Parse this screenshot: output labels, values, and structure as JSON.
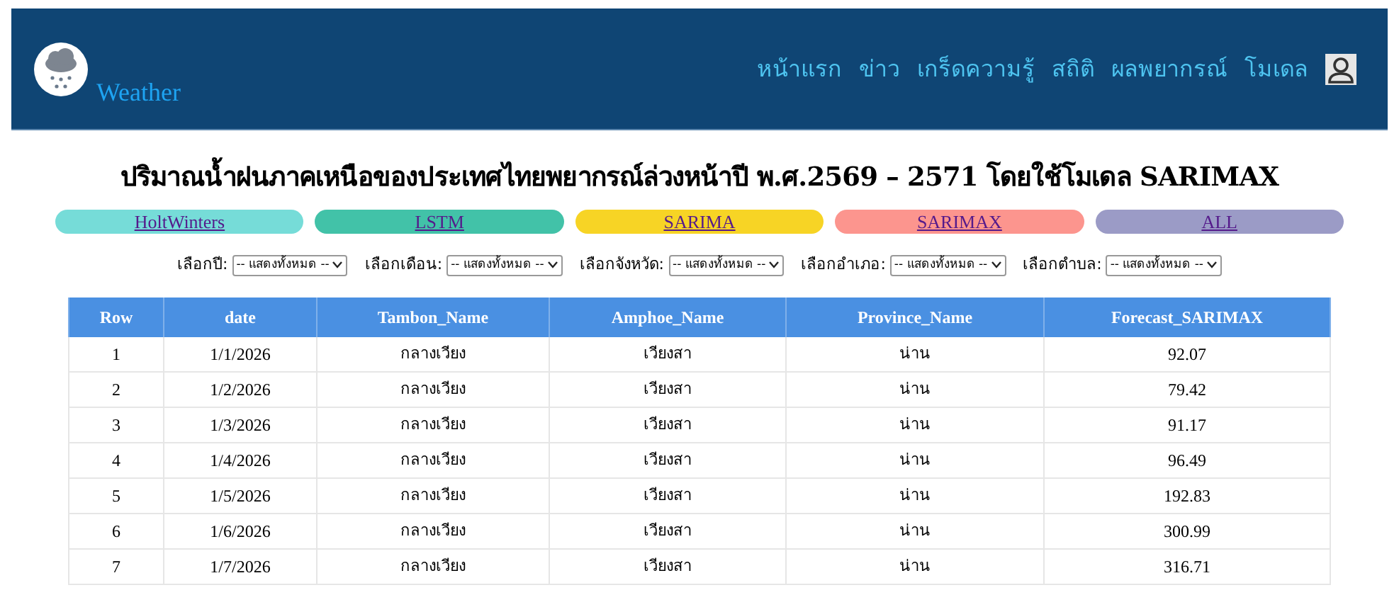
{
  "header": {
    "brand": "Weather",
    "nav": [
      "หน้าแรก",
      "ข่าว",
      "เกร็ดความรู้",
      "สถิติ",
      "ผลพยากรณ์",
      "โมเดล"
    ]
  },
  "title": "ปริมาณน้ำฝนภาคเหนือของประเทศไทยพยากรณ์ล่วงหน้าปี พ.ศ.2569 – 2571 โดยใช้โมเดล SARIMAX",
  "model_tabs": [
    {
      "label": "HoltWinters",
      "color": "#76dcd8"
    },
    {
      "label": "LSTM",
      "color": "#42c2a8"
    },
    {
      "label": "SARIMA",
      "color": "#f7d425"
    },
    {
      "label": "SARIMAX",
      "color": "#fc958e"
    },
    {
      "label": "ALL",
      "color": "#9b9bc6"
    }
  ],
  "filters": [
    {
      "label": "เลือกปี:",
      "value": "-- แสดงทั้งหมด --"
    },
    {
      "label": "เลือกเดือน:",
      "value": "-- แสดงทั้งหมด --"
    },
    {
      "label": "เลือกจังหวัด:",
      "value": "-- แสดงทั้งหมด --"
    },
    {
      "label": "เลือกอำเภอ:",
      "value": "-- แสดงทั้งหมด --"
    },
    {
      "label": "เลือกตำบล:",
      "value": "-- แสดงทั้งหมด --"
    }
  ],
  "table": {
    "columns": [
      "Row",
      "date",
      "Tambon_Name",
      "Amphoe_Name",
      "Province_Name",
      "Forecast_SARIMAX"
    ],
    "rows": [
      [
        "1",
        "1/1/2026",
        "กลางเวียง",
        "เวียงสา",
        "น่าน",
        "92.07"
      ],
      [
        "2",
        "1/2/2026",
        "กลางเวียง",
        "เวียงสา",
        "น่าน",
        "79.42"
      ],
      [
        "3",
        "1/3/2026",
        "กลางเวียง",
        "เวียงสา",
        "น่าน",
        "91.17"
      ],
      [
        "4",
        "1/4/2026",
        "กลางเวียง",
        "เวียงสา",
        "น่าน",
        "96.49"
      ],
      [
        "5",
        "1/5/2026",
        "กลางเวียง",
        "เวียงสา",
        "น่าน",
        "192.83"
      ],
      [
        "6",
        "1/6/2026",
        "กลางเวียง",
        "เวียงสา",
        "น่าน",
        "300.99"
      ],
      [
        "7",
        "1/7/2026",
        "กลางเวียง",
        "เวียงสา",
        "น่าน",
        "316.71"
      ]
    ]
  }
}
